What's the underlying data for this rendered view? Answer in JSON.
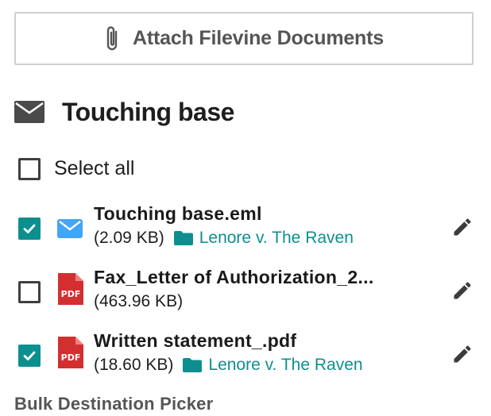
{
  "attach_button": {
    "label": "Attach Filevine Documents",
    "icon": "paperclip-icon"
  },
  "email": {
    "subject": "Touching base",
    "icon": "envelope-icon"
  },
  "select_all": {
    "label": "Select all",
    "checked": false
  },
  "files": [
    {
      "name": "Touching base.eml",
      "size": "(2.09 KB)",
      "destination": "Lenore v. The Raven",
      "checked": true,
      "type_icon": "email-file-icon"
    },
    {
      "name": "Fax_Letter of Authorization_2...",
      "size": "(463.96 KB)",
      "destination": "",
      "checked": false,
      "type_icon": "pdf-file-icon"
    },
    {
      "name": "Written statement_.pdf",
      "size": "(18.60 KB)",
      "destination": "Lenore v. The Raven",
      "checked": true,
      "type_icon": "pdf-file-icon"
    }
  ],
  "bulk_picker": {
    "label": "Bulk Destination Picker"
  },
  "colors": {
    "accent": "#0e8f8f",
    "pdf_red": "#d32f2f",
    "email_blue": "#42a5f5"
  }
}
